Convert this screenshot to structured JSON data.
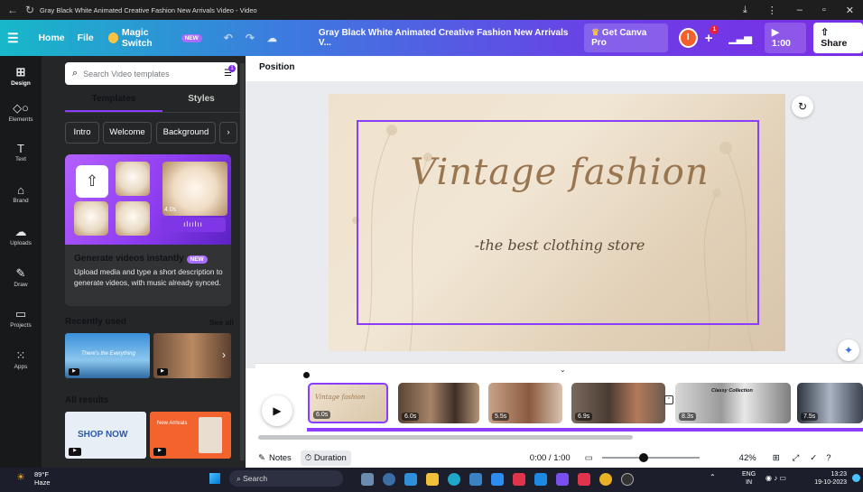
{
  "window": {
    "title": "Gray Black White Animated Creative Fashion New Arrivals Video - Video"
  },
  "header": {
    "menu_icon": "hamburger-icon",
    "home": "Home",
    "file": "File",
    "magic_switch": "Magic Switch",
    "magic_badge": "NEW",
    "doc_title": "Gray Black White Animated Creative Fashion New Arrivals V...",
    "get_pro": "Get Canva Pro",
    "avatar_initial": "I",
    "notif_count": "1",
    "play_time": "1:00",
    "share": "Share"
  },
  "rail": {
    "items": [
      {
        "label": "Design",
        "icon": "layout-icon"
      },
      {
        "label": "Elements",
        "icon": "shapes-icon"
      },
      {
        "label": "Text",
        "icon": "text-icon"
      },
      {
        "label": "Brand",
        "icon": "brand-icon"
      },
      {
        "label": "Uploads",
        "icon": "upload-icon"
      },
      {
        "label": "Draw",
        "icon": "draw-icon"
      },
      {
        "label": "Projects",
        "icon": "folder-icon"
      },
      {
        "label": "Apps",
        "icon": "apps-icon"
      }
    ]
  },
  "panel": {
    "search_placeholder": "Search Video templates",
    "filter_count": "1",
    "tabs": [
      "Templates",
      "Styles"
    ],
    "chips": [
      "Intro",
      "Welcome",
      "Background"
    ],
    "promo": {
      "title": "Generate videos instantly",
      "badge": "NEW",
      "description": "Upload media and type a short description to generate videos, with music already synced.",
      "duration": "4.0s"
    },
    "recent_heading": "Recently used",
    "see_all": "See all",
    "recent_thumb_text": "There's the Everything",
    "all_results_heading": "All results",
    "result_text_1": "SHOP NOW",
    "result_text_2": "New Arrivals"
  },
  "workspace": {
    "position_label": "Position",
    "canvas_title": "Vintage fashion",
    "canvas_subtitle": "-the best clothing store",
    "clips": [
      {
        "duration": "6.0s"
      },
      {
        "duration": "6.0s"
      },
      {
        "duration": "5.5s"
      },
      {
        "duration": "6.9s"
      },
      {
        "duration": "8.3s"
      },
      {
        "duration": "7.5s"
      }
    ],
    "clip_text_classy": "Classy Collection"
  },
  "bottombar": {
    "notes": "Notes",
    "duration": "Duration",
    "time": "0:00 / 1:00",
    "zoom": "42%",
    "zoom_level": 0.42
  },
  "taskbar": {
    "temp": "89°F",
    "weather": "Haze",
    "search": "Search",
    "lang": "ENG",
    "region": "IN",
    "time": "13:23",
    "date": "19-10-2023"
  },
  "colors": {
    "accent": "#8b3dff",
    "panel": "#252627",
    "rail": "#18191b",
    "canvas_text": "#9a7650"
  }
}
